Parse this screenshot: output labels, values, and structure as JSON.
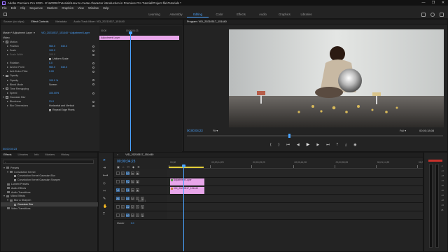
{
  "window": {
    "title": "Adobe Premiere Pro 2020 - E:\\WORK\\Tutorials\\How to create character introduction in Premiere Pro Tutorial\\Project file\\Tutorials *",
    "controls": [
      "—",
      "❐",
      "✕"
    ]
  },
  "menu": [
    "File",
    "Edit",
    "Clip",
    "Sequence",
    "Markers",
    "Graphics",
    "View",
    "Window",
    "Help"
  ],
  "workspaces": {
    "tabs": [
      "Learning",
      "Assembly",
      "Editing",
      "Color",
      "Effects",
      "Audio",
      "Graphics",
      "Libraries"
    ],
    "active": "Editing"
  },
  "effect_controls": {
    "tabs": [
      "Source: (no clips)",
      "Effect Controls",
      "Metadata",
      "Audio Track Mixer: VID_20210517_151440"
    ],
    "active_tab": "Effect Controls",
    "header_source": "Master * Adjustment Layer",
    "header_clip": "VID_20210517_151440 * Adjustment Layer",
    "mini_timeline_start": "00:00",
    "mini_timeline_mark": "00:00:04:23",
    "clip_name": "Adjustment Layer",
    "section_video": "Video",
    "rows": [
      {
        "type": "section",
        "label": "Motion"
      },
      {
        "type": "prop",
        "label": "Position",
        "v1": "960.0",
        "v2": "540.0"
      },
      {
        "type": "prop",
        "label": "Scale",
        "v1": "100.0"
      },
      {
        "type": "prop-dim",
        "label": "Scale Width",
        "v1": "100.0"
      },
      {
        "type": "check",
        "label": "Uniform Scale"
      },
      {
        "type": "prop",
        "label": "Rotation",
        "v1": "0.0"
      },
      {
        "type": "prop",
        "label": "Anchor Point",
        "v1": "960.0",
        "v2": "540.0"
      },
      {
        "type": "prop",
        "label": "Anti-flicker Filter",
        "v1": "0.00"
      },
      {
        "type": "section",
        "label": "Opacity"
      },
      {
        "type": "prop",
        "label": "Opacity",
        "v1": "100.0 %"
      },
      {
        "type": "text",
        "label": "Blend Mode",
        "v1": "Screen"
      },
      {
        "type": "section",
        "label": "Time Remapping"
      },
      {
        "type": "prop",
        "label": "Speed",
        "v1": "100.00%"
      },
      {
        "type": "section",
        "label": "Gaussian Blur"
      },
      {
        "type": "prop",
        "label": "Blurriness",
        "v1": "21.0"
      },
      {
        "type": "text",
        "label": "Blur Dimensions",
        "v1": "Horizontal and Vertical"
      },
      {
        "type": "check",
        "label": "Repeat Edge Pixels"
      }
    ],
    "footer_timecode": "00:00:04:23"
  },
  "program_monitor": {
    "title": "Program: VID_20210517_151440",
    "timecode_left": "00;00;04;23",
    "fit": "Fit",
    "quality": "Full",
    "timecode_right": "00;00;18;08"
  },
  "project_panel": {
    "tabs": [
      "Effects",
      "Libraries",
      "Info",
      "Markers",
      "History"
    ],
    "active_tab": "Effects",
    "tree": [
      {
        "indent": 0,
        "label": "Presets",
        "open": true
      },
      {
        "indent": 1,
        "label": "Convolution Kernel",
        "open": true
      },
      {
        "indent": 2,
        "label": "Convolution Kernel Gaussian Blur"
      },
      {
        "indent": 2,
        "label": "Convolution Kernel Gaussian Sharpen"
      },
      {
        "indent": 0,
        "label": "Lumetri Presets"
      },
      {
        "indent": 0,
        "label": "Audio Effects"
      },
      {
        "indent": 0,
        "label": "Audio Transitions"
      },
      {
        "indent": 0,
        "label": "Video Effects",
        "open": true
      },
      {
        "indent": 1,
        "label": "Blur & Sharpen",
        "open": true
      },
      {
        "indent": 2,
        "label": "Gaussian Blur",
        "selected": true
      },
      {
        "indent": 0,
        "label": "Video Transitions"
      }
    ]
  },
  "timeline": {
    "tab": "VID_20210517_151440",
    "timecode": "00;00;04;23",
    "ruler": [
      "00;00",
      "00;00;14;29",
      "00;00;29;29",
      "00;00;44;28",
      "00;00;59;28",
      "00;01;14;29",
      "00;01;29;29"
    ],
    "video_tracks": [
      "V3",
      "V2",
      "V1"
    ],
    "audio_tracks": [
      "A1",
      "A2",
      "A3"
    ],
    "clips": [
      {
        "track": "V2",
        "label": "Adjustment Layer",
        "color": "#e8a6ea"
      },
      {
        "track": "V1",
        "label": "VID_20210517_151440",
        "color": "#e8a6ea"
      }
    ],
    "audio_label": "Audio 1",
    "master_label": "Master"
  },
  "colors": {
    "accent": "#4aa3ff",
    "clip_pink": "#e8a6ea",
    "playhead": "#4aa3ff"
  }
}
